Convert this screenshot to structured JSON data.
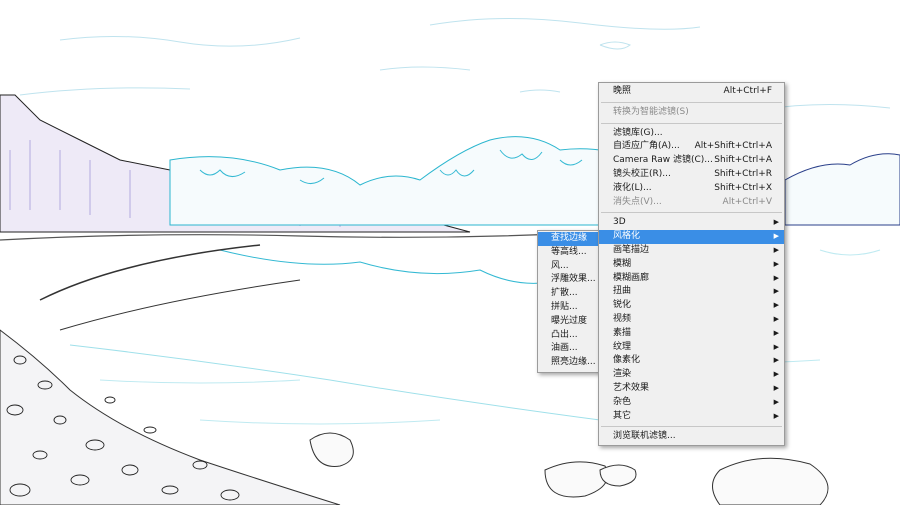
{
  "filter_menu": {
    "items": [
      {
        "label": "晚照",
        "shortcut": "Alt+Ctrl+F",
        "disabled": false
      },
      {
        "separator": true
      },
      {
        "label": "转换为智能滤镜(S)",
        "shortcut": "",
        "disabled": true
      },
      {
        "separator": true
      },
      {
        "label": "滤镜库(G)...",
        "shortcut": "",
        "disabled": false
      },
      {
        "label": "自适应广角(A)...",
        "shortcut": "Alt+Shift+Ctrl+A",
        "disabled": false
      },
      {
        "label": "Camera Raw 滤镜(C)...",
        "shortcut": "Shift+Ctrl+A",
        "disabled": false
      },
      {
        "label": "镜头校正(R)...",
        "shortcut": "Shift+Ctrl+R",
        "disabled": false
      },
      {
        "label": "液化(L)...",
        "shortcut": "Shift+Ctrl+X",
        "disabled": false
      },
      {
        "label": "消失点(V)...",
        "shortcut": "Alt+Ctrl+V",
        "disabled": true
      },
      {
        "separator": true
      },
      {
        "label": "3D",
        "submenu": true
      },
      {
        "label": "风格化",
        "submenu": true,
        "highlighted": true
      },
      {
        "label": "画笔描边",
        "submenu": true
      },
      {
        "label": "模糊",
        "submenu": true
      },
      {
        "label": "模糊画廊",
        "submenu": true
      },
      {
        "label": "扭曲",
        "submenu": true
      },
      {
        "label": "锐化",
        "submenu": true
      },
      {
        "label": "视频",
        "submenu": true
      },
      {
        "label": "素描",
        "submenu": true
      },
      {
        "label": "纹理",
        "submenu": true
      },
      {
        "label": "像素化",
        "submenu": true
      },
      {
        "label": "渲染",
        "submenu": true
      },
      {
        "label": "艺术效果",
        "submenu": true
      },
      {
        "label": "杂色",
        "submenu": true
      },
      {
        "label": "其它",
        "submenu": true
      },
      {
        "separator": true
      },
      {
        "label": "浏览联机滤镜...",
        "shortcut": "",
        "disabled": false
      }
    ]
  },
  "stylize_submenu": {
    "items": [
      {
        "label": "查找边缘",
        "highlighted": true
      },
      {
        "label": "等高线..."
      },
      {
        "label": "风..."
      },
      {
        "label": "浮雕效果..."
      },
      {
        "label": "扩散..."
      },
      {
        "label": "拼贴..."
      },
      {
        "label": "曝光过度"
      },
      {
        "label": "凸出..."
      },
      {
        "label": "油画..."
      },
      {
        "label": "照亮边缘..."
      }
    ]
  },
  "colors": {
    "highlight": "#3a8ee6",
    "menu_bg": "#f0f0f0",
    "disabled_text": "#8a8a8a"
  }
}
